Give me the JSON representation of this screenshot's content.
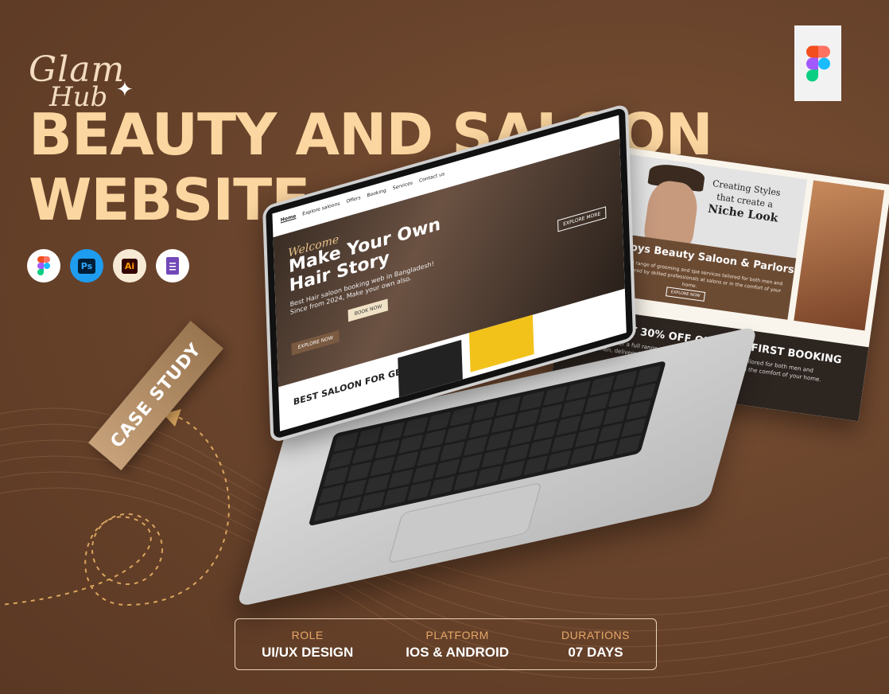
{
  "brand": {
    "logo_top": "Glam",
    "logo_bottom": "Hub"
  },
  "title": {
    "line1": "BEAUTY AND SALOON",
    "line2": "WEBSITE"
  },
  "tools": [
    {
      "icon": "figma-icon"
    },
    {
      "icon": "photoshop-icon",
      "label": "Ps"
    },
    {
      "icon": "illustrator-icon",
      "label": "Ai"
    },
    {
      "icon": "google-forms-icon"
    }
  ],
  "badge": {
    "case_study": "CASE STUDY"
  },
  "laptop_screen": {
    "nav": [
      "Home",
      "Explore saloons",
      "Offers",
      "Booking",
      "Services",
      "Contact us"
    ],
    "welcome": "Welcome",
    "headline": "Make Your Own Hair Story",
    "sub": "Best Hair saloon booking web in Bangladesh! Since from 2024, Make your own also.",
    "book_now": "BOOK NOW",
    "explore_now": "EXPLORE NOW",
    "explore_more": "EXPLORE MORE",
    "section_title": "BEST SALOON FOR GENTS"
  },
  "card": {
    "tag_line1": "Creating Styles",
    "tag_line2": "that create a",
    "tag_line3": "Niche Look",
    "heading": "Boys Beauty Saloon & Parlors",
    "desc": "Discover a full range of grooming and spa services tailored for both men and women, delivered by skilled professionals at salons or in the comfort of your home.",
    "button": "EXPLORE NOW",
    "promo_heading": "GET 30% OFF ON YOUR FIRST BOOKING",
    "promo_desc": "Discover a full range of grooming and spa services tailored for both men and women, delivered by skilled professionals at salons or in the comfort of your home."
  },
  "info": {
    "role_label": "ROLE",
    "role_value": "UI/UX DESIGN",
    "platform_label": "PLATFORM",
    "platform_value": "IOS & ANDROID",
    "duration_label": "DURATIONS",
    "duration_value": "07 DAYS"
  },
  "colors": {
    "background": "#6a442c",
    "title": "#fbd6a0",
    "label_accent": "#e6a868"
  }
}
